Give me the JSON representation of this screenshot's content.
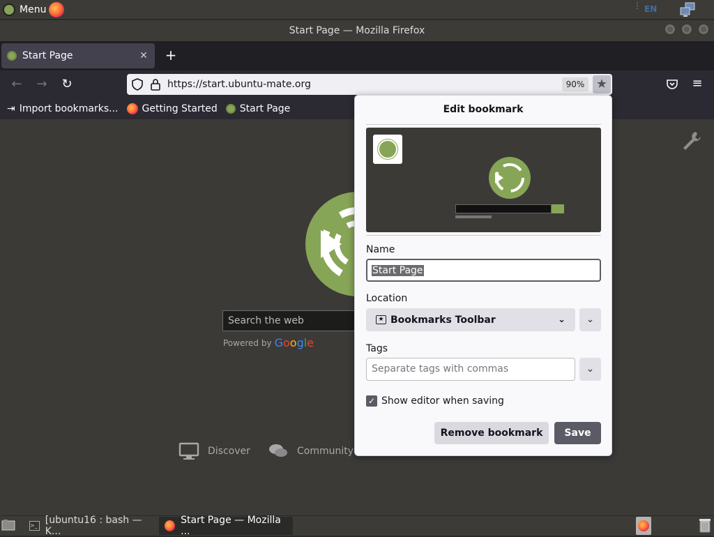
{
  "top_panel": {
    "menu_label": "Menu",
    "keyboard_layout": "EN"
  },
  "window": {
    "title": "Start Page — Mozilla Firefox"
  },
  "tabs": [
    {
      "label": "Start Page"
    }
  ],
  "urlbar": {
    "url": "https://start.ubuntu-mate.org",
    "zoom": "90%"
  },
  "bookmarks_toolbar": {
    "items": [
      "Import bookmarks...",
      "Getting Started",
      "Start Page"
    ]
  },
  "page": {
    "search_placeholder": "Search the web",
    "powered_by": "Powered by",
    "google": [
      "G",
      "o",
      "o",
      "g",
      "l",
      "e"
    ],
    "links": [
      "Discover",
      "Community"
    ]
  },
  "edit_bookmark": {
    "title": "Edit bookmark",
    "name_label": "Name",
    "name_value": "Start Page",
    "location_label": "Location",
    "location_value": "Bookmarks Toolbar",
    "tags_label": "Tags",
    "tags_placeholder": "Separate tags with commas",
    "show_editor_label": "Show editor when saving",
    "show_editor_checked": true,
    "remove_label": "Remove bookmark",
    "save_label": "Save"
  },
  "taskbar": {
    "tasks": [
      "[ubuntu16 : bash — K...",
      "Start Page — Mozilla ..."
    ]
  },
  "colors": {
    "mate_green": "#87a556",
    "panel": "#3c3b37",
    "popup_bg": "#f9f9fb",
    "primary_button": "#5b5b66"
  }
}
